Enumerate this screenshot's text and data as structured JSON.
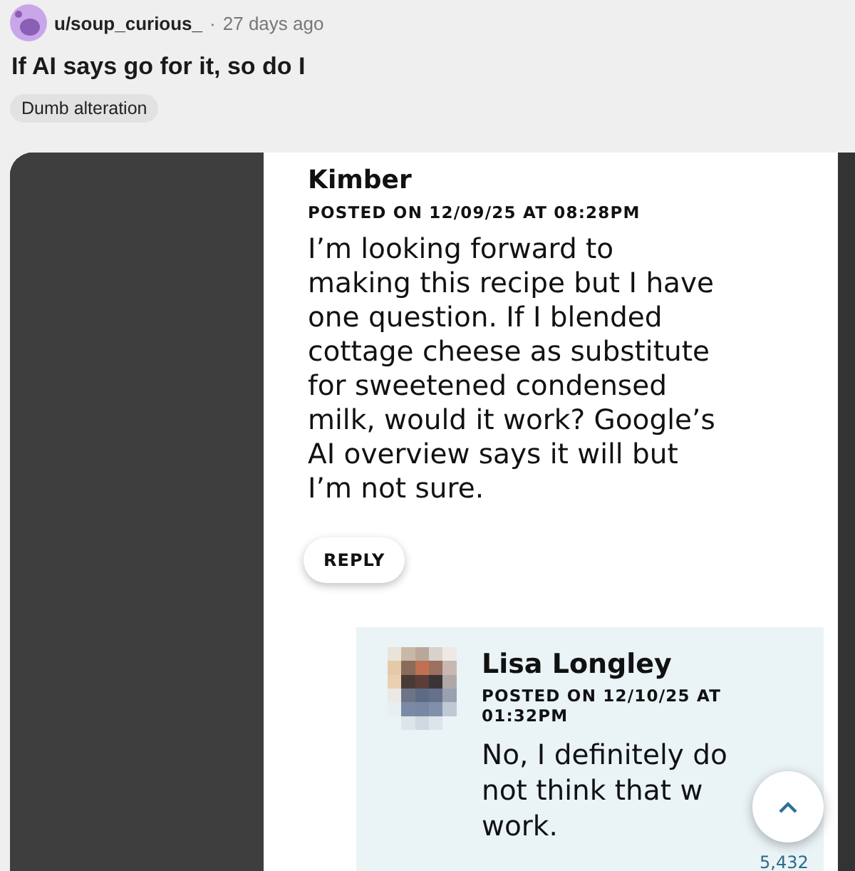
{
  "post": {
    "username": "u/soup_curious_",
    "separator": "·",
    "age": "27 days ago",
    "title": "If AI says go for it, so do I",
    "flair": "Dumb alteration"
  },
  "comment": {
    "author": "Kimber",
    "posted": "POSTED ON 12/09/25 AT 08:28PM",
    "lines": [
      "I’m looking forward to",
      "making this recipe but I have",
      "one question. If I blended",
      "cottage cheese as substitute",
      "for sweetened condensed",
      "milk, would it work? Google’s",
      "AI overview says it will but",
      "I’m not sure."
    ],
    "reply_button": "REPLY"
  },
  "reply": {
    "author": "Lisa Longley",
    "posted_lines": [
      "POSTED ON 12/10/25 AT",
      "01:32PM"
    ],
    "lines": [
      "No, I definitely do",
      "not think that w",
      "work."
    ],
    "count": "5,432"
  }
}
